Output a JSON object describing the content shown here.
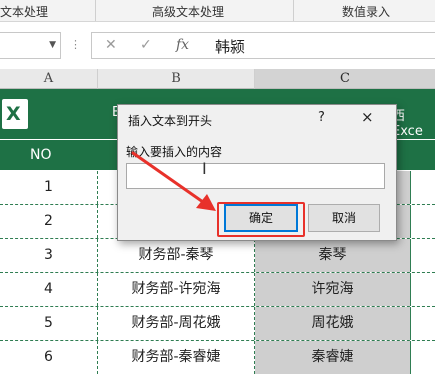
{
  "ribbon": {
    "groups": [
      "文本处理",
      "高级文本处理",
      "数值录入"
    ]
  },
  "formula_bar": {
    "name_box": "",
    "cancel_icon": "✕",
    "enter_icon": "✓",
    "fx_label": "fx",
    "value": "韩颍"
  },
  "columns": [
    "A",
    "B",
    "C"
  ],
  "banner": {
    "logo_letter": "X",
    "left_text": "E",
    "right_text": "西Exce"
  },
  "header_row": {
    "col_a": "NO"
  },
  "rows": [
    {
      "no": "1",
      "b": "",
      "c": ""
    },
    {
      "no": "2",
      "b": "",
      "c": ""
    },
    {
      "no": "3",
      "b": "财务部-秦琴",
      "c": "秦琴"
    },
    {
      "no": "4",
      "b": "财务部-许宛海",
      "c": "许宛海"
    },
    {
      "no": "5",
      "b": "财务部-周花娥",
      "c": "周花娥"
    },
    {
      "no": "6",
      "b": "财务部-秦睿婕",
      "c": "秦睿婕"
    }
  ],
  "dialog": {
    "title": "插入文本到开头",
    "help": "?",
    "close": "×",
    "prompt": "输入要插入的内容",
    "input_value": "",
    "ok_label": "确定",
    "cancel_label": "取消"
  },
  "colors": {
    "excel_green": "#1e7145",
    "selected_column": "#cfcfcf",
    "annotation_red": "#e8312a",
    "focus_blue": "#0078d7"
  }
}
